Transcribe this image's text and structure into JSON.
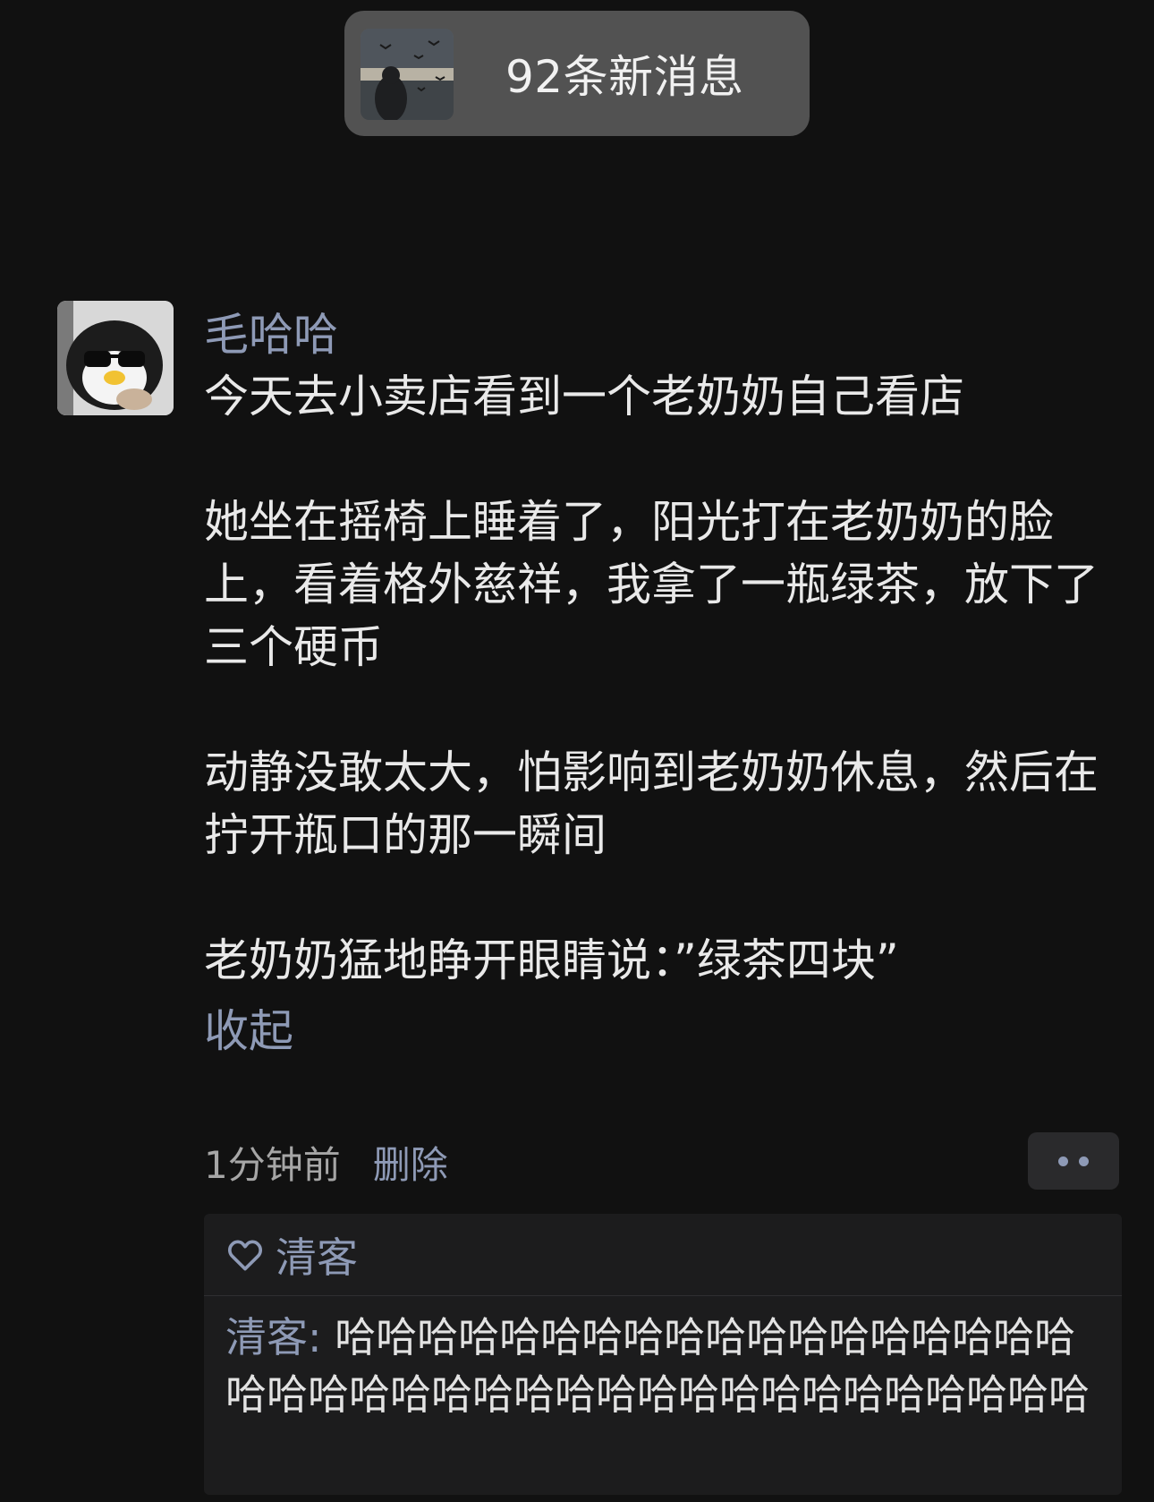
{
  "notification": {
    "text": "92条新消息",
    "thumbnail_icon": "seagulls-photo-thumbnail"
  },
  "post": {
    "author": "毛哈哈",
    "avatar_icon": "penguin-sunglasses-avatar",
    "paragraphs": [
      "今天去小卖店看到一个老奶奶自己看店",
      "她坐在摇椅上睡着了，阳光打在老奶奶的脸上，看着格外慈祥，我拿了一瓶绿茶，放下了三个硬币",
      "动静没敢太大，怕影响到老奶奶休息，然后在拧开瓶口的那一瞬间",
      "老奶奶猛地睁开眼睛说：”绿茶四块”"
    ],
    "collapse_label": "收起",
    "time": "1分钟前",
    "delete_label": "删除"
  },
  "likes": {
    "names": "清客"
  },
  "comments": [
    {
      "name": "清客",
      "separator": ": ",
      "text": "哈哈哈哈哈哈哈哈哈哈哈哈哈哈哈哈哈哈哈哈哈哈哈哈哈哈哈哈哈哈哈哈哈哈哈哈哈哈哈"
    }
  ],
  "colors": {
    "background": "#111111",
    "link": "#8e9ab6",
    "text": "#e9e9e9",
    "pill": "#525252"
  }
}
